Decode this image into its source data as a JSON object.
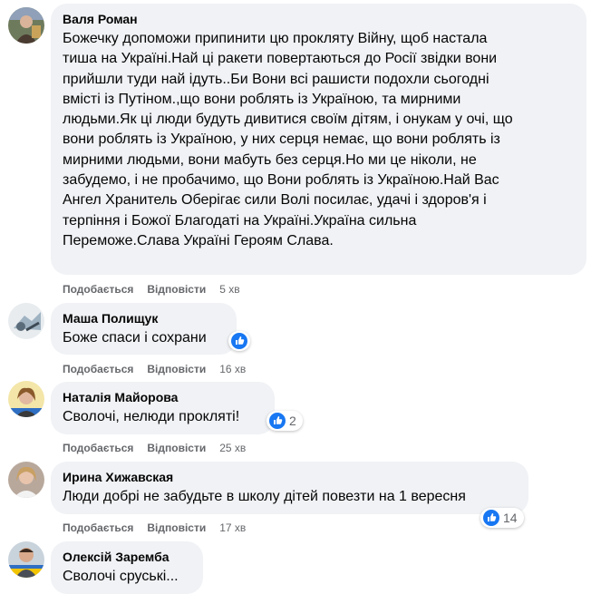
{
  "comments": [
    {
      "author": "Валя Роман",
      "text": "Божечку допоможи припинити цю прокляту Війну, щоб настала\nтиша на Україні.Най ці ракети повертаються до Росії звідки вони\nприйшли туди най ідуть..Би Вони всі рашисти подохли сьогодні\nвмісті із Путіном.,що вони роблять із Україною, та мирними\nлюдьми.Як ці люди будуть дивитися своїм дітям, і онукам у очі, що\nвони роблять із Україною, у них серця немає, що вони роблять із\nмирними людьми, вони мабуть без серця.Но ми це ніколи, не\nзабудемо, і не пробачимо, що Вони роблять із Україною.Най Вас\nАнгел Хранитель Оберігає сили Волі посилає, удачі і здоров'я і\nтерпіння і Божої Благодаті на Україні.Україна сильна\nПереможе.Слава Україні Героям Слава.",
      "like": "Подобається",
      "reply": "Відповісти",
      "time": "5 хв"
    },
    {
      "author": "Маша Полищук",
      "text": "Боже спаси і сохрани",
      "like": "Подобається",
      "reply": "Відповісти",
      "time": "16 хв",
      "reaction_icon": "like-icon"
    },
    {
      "author": "Наталія Майорова",
      "text": "Сволочі, нелюди прокляті!",
      "like": "Подобається",
      "reply": "Відповісти",
      "time": "25 хв",
      "reaction_icon": "like-icon",
      "reaction_count": "2"
    },
    {
      "author": "Ирина Хижавская",
      "text": "Люди добрі не забудьте в школу дітей повезти на 1 вересня",
      "like": "Подобається",
      "reply": "Відповісти",
      "time": "17 хв",
      "reaction_icon": "like-icon",
      "reaction_count": "14"
    },
    {
      "author": "Олексій Заремба",
      "text": "Сволочі сруські..."
    }
  ],
  "colors": {
    "bubble": "#f0f2f5",
    "meta": "#65676b",
    "like_blue": "#1877f2"
  }
}
